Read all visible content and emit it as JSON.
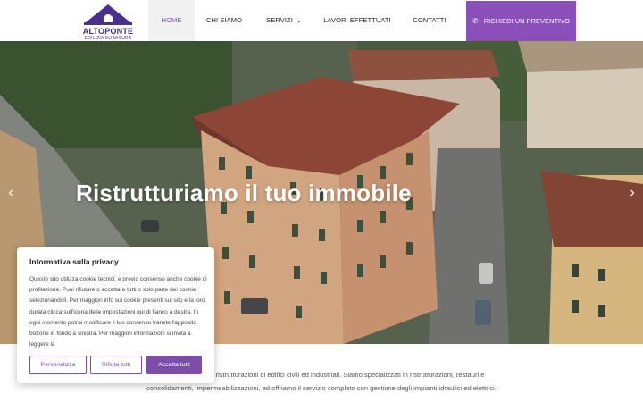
{
  "header": {
    "logo": {
      "name": "ALTOPONTE",
      "tagline": "EDILIZIA SU MISURA"
    },
    "nav": [
      {
        "label": "HOME",
        "active": true
      },
      {
        "label": "CHI SIAMO"
      },
      {
        "label": "SERVIZI",
        "icon": "chevron-down-icon"
      },
      {
        "label": "LAVORI EFFETTUATI"
      },
      {
        "label": "CONTATTI"
      }
    ],
    "cta": {
      "label": "RICHIEDI UN PREVENTIVO",
      "icon": "phone-icon"
    },
    "accent_color": "#8a4fb8"
  },
  "hero": {
    "title": "Ristrutturiamo il tuo immobile",
    "prev_icon": "chevron-left-icon",
    "next_icon": "chevron-right-icon"
  },
  "intro": {
    "text": "… ci occupiamo di ristrutturazioni di edifici civili ed industriali. Siamo specializzati in ristrutturazioni, restauri e consolidamenti, impermeabilizzazioni, ed offriamo il servizio completo con gestione degli impianti idraulici ed elettrici."
  },
  "cookie_banner": {
    "title": "Informativa sulla privacy",
    "text": "Questo sito utilizza cookie tecnici, e previo consenso anche cookie di profilazione. Puoi rifiutare o accettare tutti o solo parte dei cookie selezionandoli. Per maggiori info sui cookie presenti sul sito e la loro durata clicca sull'icona delle impostazioni qui di fianco a destra. In ogni momento potrai modificare il tuo consenso tramite l'apposito bottone in fondo a sinistra. Per maggiori informazioni si invita a leggere la",
    "buttons": {
      "customize": "Personalizza",
      "reject": "Rifiuta tutti",
      "accept": "Accetta tutti"
    }
  }
}
